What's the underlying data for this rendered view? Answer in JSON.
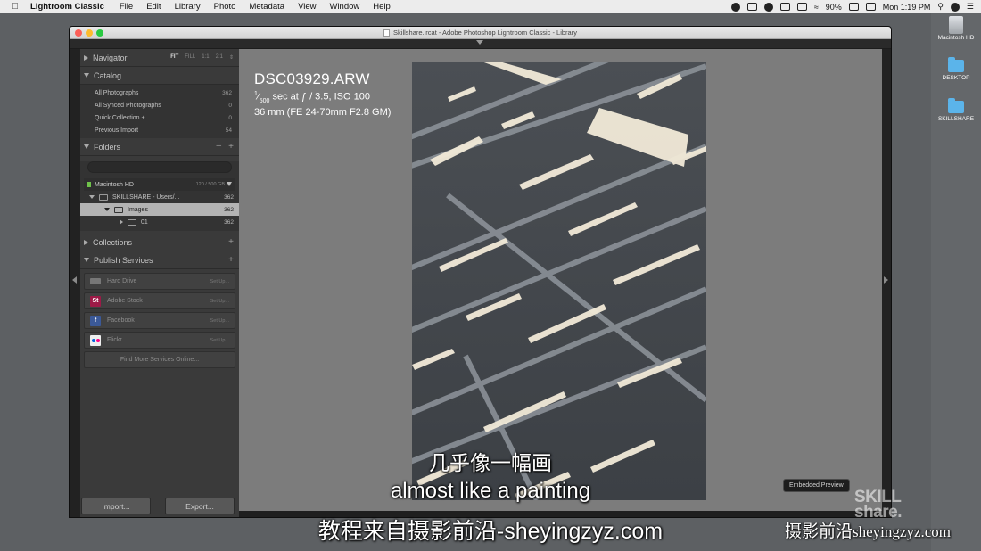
{
  "menubar": {
    "app": "Lightroom Classic",
    "items": [
      "File",
      "Edit",
      "Library",
      "Photo",
      "Metadata",
      "View",
      "Window",
      "Help"
    ],
    "battery": "90%",
    "clock": "Mon 1:19 PM"
  },
  "desktop": {
    "icons": [
      "Macintosh HD",
      "DESKTOP",
      "SKILLSHARE"
    ]
  },
  "window": {
    "title": "Skillshare.lrcat - Adobe Photoshop Lightroom Classic - Library"
  },
  "left_panel": {
    "navigator": {
      "title": "Navigator",
      "options": [
        "FIT",
        "FILL",
        "1:1",
        "2:1"
      ]
    },
    "catalog": {
      "title": "Catalog",
      "items": [
        {
          "label": "All Photographs",
          "count": "362"
        },
        {
          "label": "All Synced Photographs",
          "count": "0"
        },
        {
          "label": "Quick Collection +",
          "count": "0"
        },
        {
          "label": "Previous Import",
          "count": "54"
        }
      ]
    },
    "folders": {
      "title": "Folders",
      "volume": {
        "name": "Macintosh HD",
        "size": "120 / 500 GB"
      },
      "tree": [
        {
          "label": "SKILLSHARE - Users/...",
          "count": "362"
        },
        {
          "label": "Images",
          "count": "362"
        },
        {
          "label": "01",
          "count": "362"
        }
      ]
    },
    "collections": {
      "title": "Collections"
    },
    "publish": {
      "title": "Publish Services",
      "services": [
        {
          "name": "Hard Drive",
          "setup": "Set Up..."
        },
        {
          "name": "Adobe Stock",
          "setup": "Set Up..."
        },
        {
          "name": "Facebook",
          "setup": "Set Up..."
        },
        {
          "name": "Flickr",
          "setup": "Set Up..."
        }
      ],
      "find_more": "Find More Services Online..."
    },
    "buttons": {
      "import": "Import...",
      "export": "Export..."
    }
  },
  "loupe": {
    "filename": "DSC03929.ARW",
    "shutter_num": "1",
    "shutter_den": "500",
    "exposure_rest": " sec at ƒ / 3.5, ISO 100",
    "lens": "36 mm (FE 24-70mm F2.8 GM)",
    "badge": "Embedded Preview"
  },
  "overlay": {
    "subtitle_cn": "几乎像一幅画",
    "subtitle_en": "almost like a painting",
    "ad": "教程来自摄影前沿-sheyingzyz.com",
    "logo_line1": "SKILL",
    "logo_line2": "share.",
    "wm_cn": "摄影前沿",
    "wm_domain": "sheyingzyz.com"
  }
}
